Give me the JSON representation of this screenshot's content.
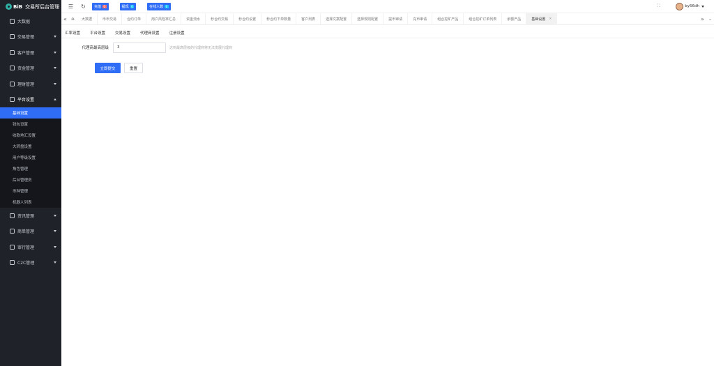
{
  "app": {
    "logo_text": "BiB",
    "title": "交易所后台管理"
  },
  "sidebar": {
    "menu_top": [
      {
        "label": "大数据",
        "icon": "dashboard-icon"
      },
      {
        "label": "交易管理",
        "icon": "exchange-icon"
      },
      {
        "label": "客户管理",
        "icon": "users-icon"
      },
      {
        "label": "资金管理",
        "icon": "wallet-icon"
      },
      {
        "label": "理财管理",
        "icon": "piggy-bank-icon"
      },
      {
        "label": "平台设置",
        "icon": "settings-icon"
      }
    ],
    "submenu": [
      {
        "label": "基础设置",
        "active": true
      },
      {
        "label": "钱包设置"
      },
      {
        "label": "收款地汇设置"
      },
      {
        "label": "大转盘设置"
      },
      {
        "label": "用户等级设置"
      },
      {
        "label": "角色管理"
      },
      {
        "label": "后台管理员"
      },
      {
        "label": "币种管理"
      },
      {
        "label": "机器人列表"
      }
    ],
    "menu_bottom": [
      {
        "label": "资讯管理",
        "icon": "news-icon"
      },
      {
        "label": "商单管理",
        "icon": "order-icon"
      },
      {
        "label": "审行管理",
        "icon": "tools-icon"
      },
      {
        "label": "C2C管理",
        "icon": "c2c-icon"
      }
    ]
  },
  "topbar": {
    "recharge_label": "充值",
    "recharge_count": "0",
    "withdraw_label": "提现",
    "withdraw_count": "0",
    "online_label": "在线人数",
    "online_count": "0",
    "username": "by56dh"
  },
  "tabs": [
    "大数据",
    "币币交易",
    "合约订单",
    "用户风险率汇总",
    "资金流水",
    "秒合约交易",
    "秒合约设置",
    "秒合约下单数量",
    "客户列表",
    "选择文案配置",
    "选择规则配置",
    "提币审请",
    "充币审请",
    "组合挖矿产品",
    "组合挖矿订单列表",
    "余额产品",
    "基础设置"
  ],
  "active_tab": "基础设置",
  "subtabs": [
    "汇率设置",
    "平台设置",
    "交易设置",
    "代理商设置",
    "注册设置"
  ],
  "form": {
    "agent_level_label": "代理商最高层级",
    "agent_level_value": "3",
    "agent_level_hint": "达到最高层级的代理商将无法发展代理商",
    "submit_label": "立即提交",
    "reset_label": "重置"
  }
}
